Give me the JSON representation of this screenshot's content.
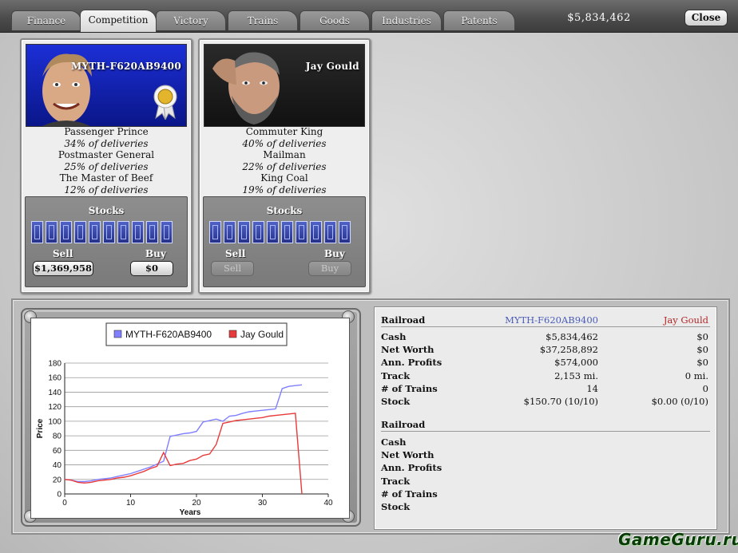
{
  "tabs": [
    {
      "label": "Finance",
      "active": false
    },
    {
      "label": "Competition",
      "active": true
    },
    {
      "label": "Victory",
      "active": false
    },
    {
      "label": "Trains",
      "active": false
    },
    {
      "label": "Goods",
      "active": false
    },
    {
      "label": "Industries",
      "active": false
    },
    {
      "label": "Patents",
      "active": false
    }
  ],
  "header": {
    "money": "$5,834,462",
    "close_label": "Close"
  },
  "players": [
    {
      "name": "MYTH-F620AB9400",
      "portrait_icon": "tycoon-portrait-smiling",
      "badge_icon": "gold-medal-icon",
      "titles": [
        {
          "title": "Passenger Prince",
          "share": "34% of deliveries"
        },
        {
          "title": "Postmaster General",
          "share": "25% of deliveries"
        },
        {
          "title": "The Master of Beef",
          "share": "12% of deliveries"
        }
      ],
      "stocks_label": "Stocks",
      "sell_label": "Sell",
      "buy_label": "Buy",
      "sell_value": "$1,369,958",
      "buy_value": "$0",
      "sell_enabled": true,
      "buy_enabled": true
    },
    {
      "name": "Jay Gould",
      "portrait_icon": "tycoon-portrait-bearded",
      "titles": [
        {
          "title": "Commuter King",
          "share": "40% of deliveries"
        },
        {
          "title": "Mailman",
          "share": "22% of deliveries"
        },
        {
          "title": "King Coal",
          "share": "19% of deliveries"
        }
      ],
      "stocks_label": "Stocks",
      "sell_label": "Sell",
      "buy_label": "Buy",
      "sell_value": "Sell",
      "buy_value": "Buy",
      "sell_enabled": false,
      "buy_enabled": false
    }
  ],
  "colors": {
    "series1": "#7f7fff",
    "series2": "#e83a3a",
    "accent_blue": "#4a5cb8",
    "accent_red": "#b52626"
  },
  "chart_data": {
    "type": "line",
    "xlabel": "Years",
    "ylabel": "Price",
    "xlim": [
      0,
      40
    ],
    "ylim": [
      0,
      180
    ],
    "xticks": [
      0,
      10,
      20,
      30,
      40
    ],
    "yticks": [
      0,
      20,
      40,
      60,
      80,
      100,
      120,
      140,
      160,
      180
    ],
    "legend_position": "top",
    "series": [
      {
        "name": "MYTH-F620AB9400",
        "color": "#7f7fff",
        "x": [
          0,
          1,
          2,
          3,
          4,
          5,
          6,
          7,
          8,
          9,
          10,
          11,
          12,
          13,
          14,
          15,
          16,
          17,
          18,
          19,
          20,
          21,
          22,
          23,
          24,
          25,
          26,
          27,
          28,
          29,
          30,
          31,
          32,
          33,
          34,
          35,
          36
        ],
        "y": [
          20,
          19,
          17,
          17,
          18,
          20,
          21,
          22,
          24,
          26,
          28,
          31,
          34,
          37,
          41,
          45,
          79,
          81,
          83,
          84,
          86,
          99,
          101,
          103,
          100,
          107,
          108,
          111,
          113,
          114,
          115,
          116,
          117,
          145,
          148,
          149,
          150
        ]
      },
      {
        "name": "Jay Gould",
        "color": "#e83a3a",
        "x": [
          0,
          1,
          2,
          3,
          4,
          5,
          6,
          7,
          8,
          9,
          10,
          11,
          12,
          13,
          14,
          15,
          16,
          17,
          18,
          19,
          20,
          21,
          22,
          23,
          24,
          25,
          26,
          27,
          28,
          29,
          30,
          31,
          32,
          33,
          34,
          35,
          36
        ],
        "y": [
          20,
          19,
          16,
          15,
          16,
          18,
          19,
          20,
          22,
          23,
          25,
          28,
          31,
          35,
          38,
          57,
          39,
          41,
          42,
          46,
          48,
          53,
          55,
          68,
          97,
          99,
          101,
          102,
          103,
          104,
          105,
          107,
          108,
          109,
          110,
          111,
          0
        ]
      }
    ]
  },
  "stats": {
    "header": {
      "label": "Railroad",
      "p1": "MYTH-F620AB9400",
      "p2": "Jay Gould"
    },
    "rows": [
      {
        "label": "Cash",
        "p1": "$5,834,462",
        "p2": "$0"
      },
      {
        "label": "Net Worth",
        "p1": "$37,258,892",
        "p2": "$0"
      },
      {
        "label": "Ann. Profits",
        "p1": "$574,000",
        "p2": "$0"
      },
      {
        "label": "Track",
        "p1": "2,153 mi.",
        "p2": "0 mi."
      },
      {
        "label": "# of Trains",
        "p1": "14",
        "p2": "0"
      },
      {
        "label": "Stock",
        "p1": "$150.70 (10/10)",
        "p2": "$0.00 (0/10)"
      }
    ],
    "header2": {
      "label": "Railroad"
    },
    "rows2": [
      {
        "label": "Cash"
      },
      {
        "label": "Net Worth"
      },
      {
        "label": "Ann. Profits"
      },
      {
        "label": "Track"
      },
      {
        "label": "# of Trains"
      },
      {
        "label": "Stock"
      }
    ]
  },
  "watermark": "GameGuru.ru"
}
